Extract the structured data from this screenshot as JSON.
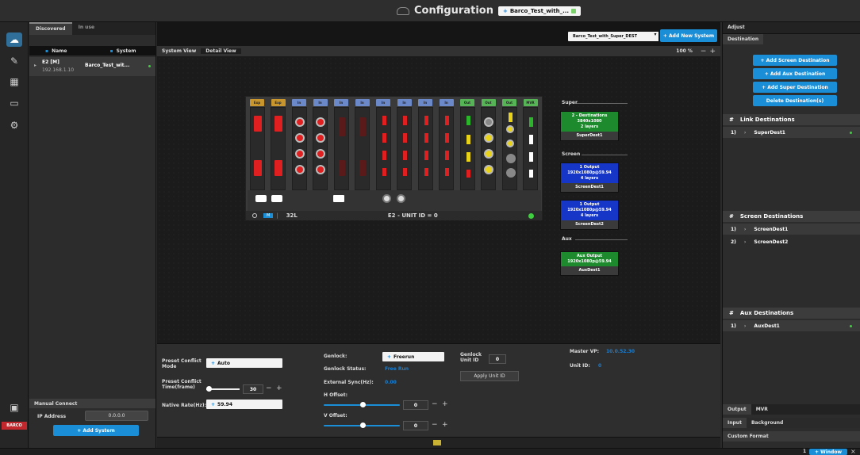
{
  "topbar": {
    "title": "Configuration",
    "chip_label": "Barco_Test_with_..."
  },
  "left": {
    "tabs": [
      "Discovered",
      "In use"
    ],
    "col_name": "Name",
    "col_system": "System",
    "system_row": {
      "name": "E2 [M]",
      "ip": "192.168.1.10",
      "system": "Barco_Test_wit..."
    },
    "manual_connect": "Manual Connect",
    "ip_label": "IP Address",
    "ip_value": "0.0.0.0",
    "add_system": "+ Add System"
  },
  "center": {
    "system_select": "Barco_Test_with_Super_DEST",
    "add_new_system": "+ Add New System",
    "view_tabs": [
      "System View",
      "Detail View"
    ],
    "zoom": "100 %",
    "zoom_minus": "−",
    "zoom_plus": "+",
    "slot_headers": [
      "Exp",
      "Exp",
      "In",
      "In",
      "In",
      "In",
      "In",
      "In",
      "In",
      "In",
      "Out",
      "Out",
      "Out",
      "MVR"
    ],
    "device_footer": {
      "mode": "M",
      "sep": "|",
      "count": "32L",
      "unit": "E2 - UNIT ID = 0"
    },
    "groups": {
      "super": "Super",
      "screen": "Screen",
      "aux": "Aux"
    },
    "dest_cards": [
      {
        "group": "super",
        "lines": [
          "2 - Destinations",
          "3840x1080",
          "2 layers"
        ],
        "label": "SuperDest1",
        "color": "#1e8a2e"
      },
      {
        "group": "screen",
        "lines": [
          "1 Output",
          "1920x1080p@59.94",
          "4 layers"
        ],
        "label": "ScreenDest1",
        "color": "#1636c8"
      },
      {
        "group": "screen",
        "lines": [
          "1 Output",
          "1920x1080p@59.94",
          "4 layers"
        ],
        "label": "ScreenDest2",
        "color": "#1636c8"
      },
      {
        "group": "aux",
        "lines": [
          "Aux Output",
          "1920x1080p@59.94"
        ],
        "label": "AuxDest1",
        "color": "#1e8a2e"
      }
    ]
  },
  "params": {
    "preset_conflict_mode_label": "Preset Conflict Mode",
    "preset_conflict_mode_value": "Auto",
    "preset_conflict_time_label": "Preset Conflict Time(frame)",
    "preset_conflict_time_value": "30",
    "native_rate_label": "Native Rate(Hz):",
    "native_rate_value": "59.94",
    "genlock_label": "Genlock:",
    "genlock_value": "Freerun",
    "genlock_status_label": "Genlock Status:",
    "genlock_status_value": "Free Run",
    "external_sync_label": "External Sync(Hz):",
    "external_sync_value": "0.00",
    "h_offset_label": "H Offset:",
    "h_offset_value": "0",
    "v_offset_label": "V Offset:",
    "v_offset_value": "0",
    "genlock_unit_label": "Genlock Unit ID",
    "genlock_unit_value": "0",
    "apply_unit_id": "Apply Unit ID",
    "master_vp_label": "Master VP:",
    "master_vp_value": "10.0.52.30",
    "unit_id_label": "Unit ID:",
    "unit_id_value": "0"
  },
  "right": {
    "tab_top": "Adjust",
    "tab_dest": "Destination",
    "buttons": [
      "+ Add Screen Destination",
      "+ Add Aux Destination",
      "+ Add Super Destination",
      "Delete Destination(s)"
    ],
    "link_title": "Link Destinations",
    "link_rows": [
      {
        "idx": "1)",
        "name": "SuperDest1"
      }
    ],
    "screen_title": "Screen Destinations",
    "screen_rows": [
      {
        "idx": "1)",
        "name": "ScreenDest1"
      },
      {
        "idx": "2)",
        "name": "ScreenDest2"
      }
    ],
    "aux_title": "Aux Destinations",
    "aux_rows": [
      {
        "idx": "1)",
        "name": "AuxDest1"
      }
    ],
    "hash": "#",
    "bottom_tabs": [
      "Output",
      "MVR"
    ],
    "bottom_tabs2": [
      "Input",
      "Background"
    ],
    "custom_format": "Custom Format"
  },
  "status": {
    "page": "1",
    "window_btn": "+ Window",
    "brand": "BARCO"
  }
}
